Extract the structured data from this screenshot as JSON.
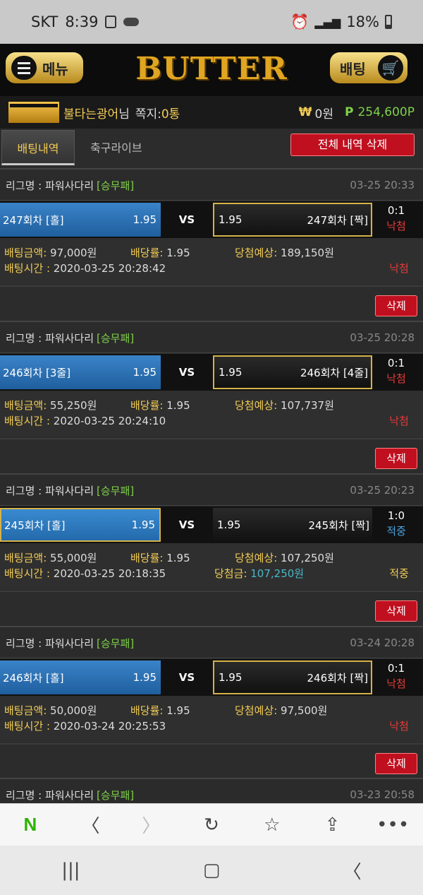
{
  "status": {
    "carrier": "SKT",
    "time": "8:39",
    "battery": "18%"
  },
  "header": {
    "menu_label": "메뉴",
    "logo": "BUTTER",
    "bet_label": "배팅"
  },
  "user": {
    "name": "불타는광어",
    "suffix": "님",
    "msg_label": "쪽지:",
    "msg_count": "0통",
    "won_symbol": "₩",
    "won_value": "0원",
    "point_symbol": "P",
    "point_value": "254,600P"
  },
  "tabs": {
    "history": "배팅내역",
    "soccer_live": "축구라이브",
    "delete_all": "전체 내역 삭제"
  },
  "labels": {
    "vs": "VS",
    "league_prefix": "리그명 : ",
    "amount": "배팅금액:",
    "odds": "배당률:",
    "expected": "당첨예상:",
    "time": "배팅시간 : ",
    "win_amount": "당첨금:",
    "delete": "삭제"
  },
  "bets": [
    {
      "league": "파워사다리",
      "type": "[승무패]",
      "date": "03-25 20:33",
      "home": "247회차 [홀]",
      "home_odds": "1.95",
      "away_odds": "1.95",
      "away": "247회차 [짝]",
      "score": "0:1",
      "result": "낙첨",
      "amount": "97,000원",
      "odds": "1.95",
      "expected": "189,150원",
      "bet_time": "2020-03-25 20:28:42",
      "selected": "away"
    },
    {
      "league": "파워사다리",
      "type": "[승무패]",
      "date": "03-25 20:28",
      "home": "246회차 [3줄]",
      "home_odds": "1.95",
      "away_odds": "1.95",
      "away": "246회차 [4줄]",
      "score": "0:1",
      "result": "낙첨",
      "amount": "55,250원",
      "odds": "1.95",
      "expected": "107,737원",
      "bet_time": "2020-03-25 20:24:10",
      "selected": "away"
    },
    {
      "league": "파워사다리",
      "type": "[승무패]",
      "date": "03-25 20:23",
      "home": "245회차 [홀]",
      "home_odds": "1.95",
      "away_odds": "1.95",
      "away": "245회차 [짝]",
      "score": "1:0",
      "result": "적중",
      "amount": "55,000원",
      "odds": "1.95",
      "expected": "107,250원",
      "bet_time": "2020-03-25 20:18:35",
      "win_amount": "107,250원",
      "selected": "home"
    },
    {
      "league": "파워사다리",
      "type": "[승무패]",
      "date": "03-24 20:28",
      "home": "246회차 [홀]",
      "home_odds": "1.95",
      "away_odds": "1.95",
      "away": "246회차 [짝]",
      "score": "0:1",
      "result": "낙첨",
      "amount": "50,000원",
      "odds": "1.95",
      "expected": "97,500원",
      "bet_time": "2020-03-24 20:25:53",
      "selected": "away"
    }
  ],
  "partial": {
    "league": "파워사다리",
    "type": "[승무패]",
    "date": "03-23 20:58"
  },
  "browser": {
    "n_logo": "N",
    "more": "•••"
  }
}
